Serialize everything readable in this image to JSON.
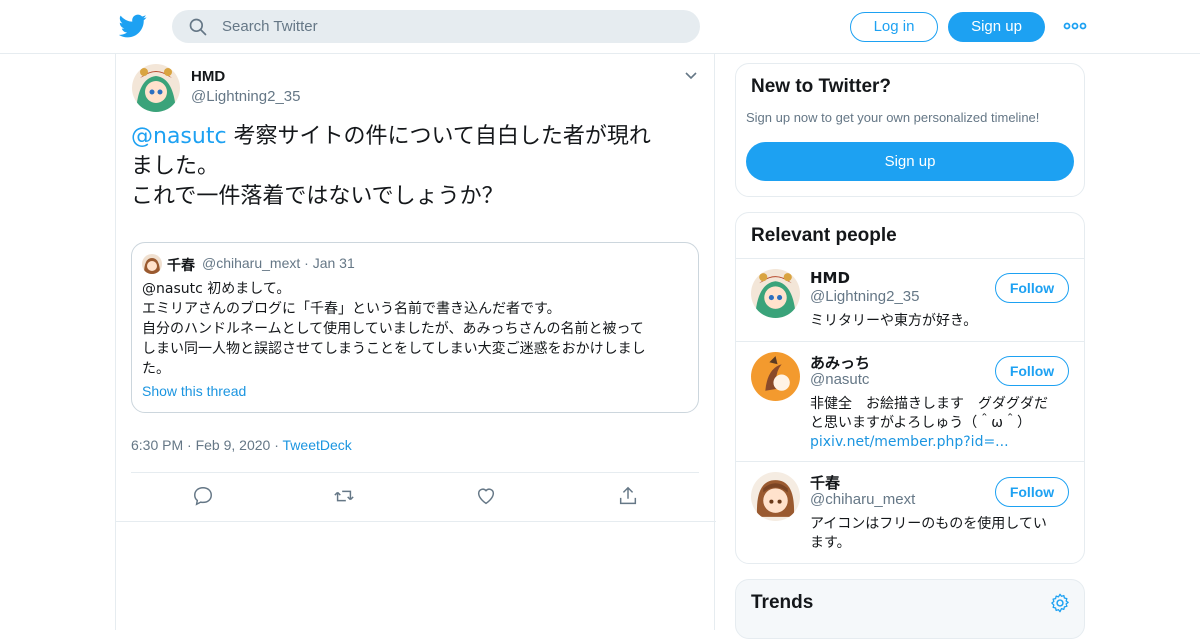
{
  "header": {
    "logo_icon": "twitter-bird-icon",
    "search_placeholder": "Search Twitter",
    "login_label": "Log in",
    "signup_label": "Sign up",
    "more_icon": "more-dots-icon"
  },
  "tweet": {
    "name": "HMD",
    "handle": "@Lightning2_35",
    "mention": "@nasutc",
    "text_line1": " 考察サイトの件について自白した者が現れ",
    "text_line2": "ました。",
    "text_line3": "これで一件落着ではないでしょうか？",
    "quote": {
      "name": "千春",
      "handle": "@chiharu_mext",
      "date_sep": "·",
      "date": "Jan 31",
      "line1": "@nasutc 初めまして。",
      "line2": "エミリアさんのブログに「千春」という名前で書き込んだ者です。",
      "line3": "自分のハンドルネームとして使用していましたが、あみっちさんの名前と被って",
      "line4": "しまい同一人物と誤認させてしまうことをしてしまい大変ご迷惑をおかけしまし",
      "line5": "た。",
      "thread_link": "Show this thread"
    },
    "time": "6:30 PM",
    "sep": "·",
    "date": "Feb 9, 2020",
    "source": "TweetDeck",
    "actions": [
      "reply-icon",
      "retweet-icon",
      "like-icon",
      "share-icon"
    ]
  },
  "new_to_twitter": {
    "title": "New to Twitter?",
    "subtitle": "Sign up now to get your own personalized timeline!",
    "button": "Sign up"
  },
  "relevant_people": {
    "title": "Relevant people",
    "follow_label": "Follow",
    "people": [
      {
        "name": "HMD",
        "handle": "@Lightning2_35",
        "bio": "ミリタリーや東方が好き。"
      },
      {
        "name": "あみっち",
        "handle": "@nasutc",
        "bio_line1": "非健全　お絵描きします　グダグダだ",
        "bio_line2": "と思いますがよろしゅう（＾ω＾）",
        "bio_link": "pixiv.net/member.php?id=..."
      },
      {
        "name": "千春",
        "handle": "@chiharu_mext",
        "bio_line1": "アイコンはフリーのものを使用してい",
        "bio_line2": "ます。"
      }
    ]
  },
  "trends": {
    "title": "Trends",
    "settings_icon": "gear-icon"
  },
  "colors": {
    "accent": "#1da1f2",
    "link": "#1b95e0",
    "muted": "#657786",
    "border": "#e6ecf0"
  }
}
